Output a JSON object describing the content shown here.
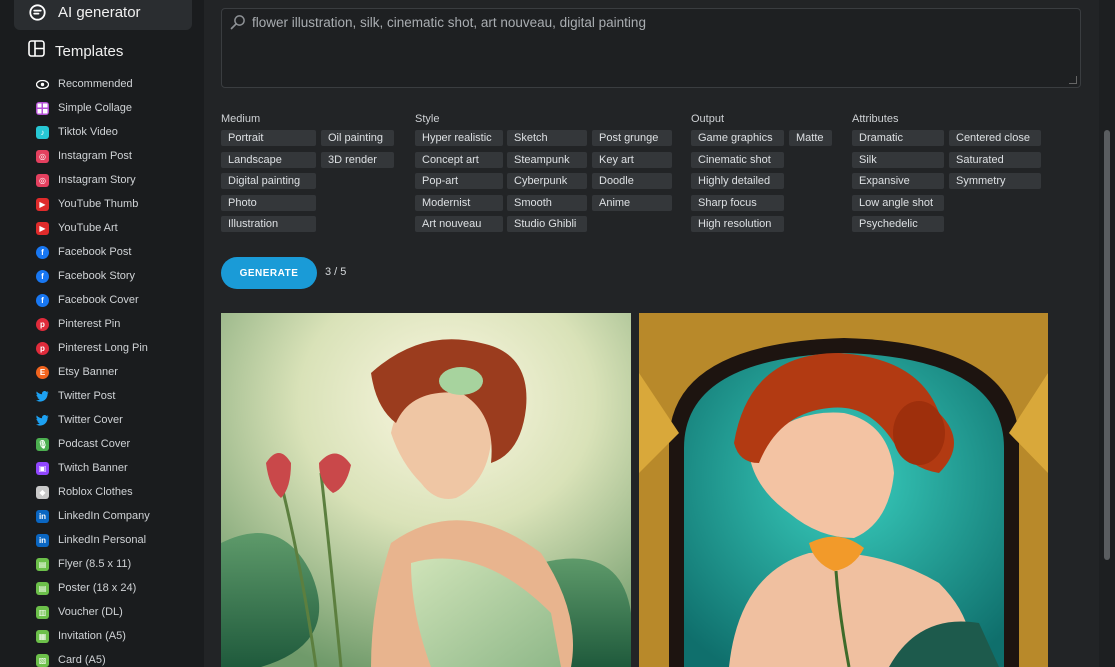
{
  "sidebar": {
    "top_label": "AI generator",
    "templates_label": "Templates",
    "items": [
      {
        "label": "Recommended",
        "icon": "eye-icon",
        "color": "#ffffff",
        "glyph": "👁"
      },
      {
        "label": "Simple Collage",
        "icon": "collage-icon",
        "color": "#b44fd6",
        "glyph": ""
      },
      {
        "label": "Tiktok Video",
        "icon": "tiktok-icon",
        "color": "#27c7d4",
        "glyph": "♪"
      },
      {
        "label": "Instagram Post",
        "icon": "instagram-icon",
        "color": "#e4405f",
        "glyph": "◎"
      },
      {
        "label": "Instagram Story",
        "icon": "instagram-icon",
        "color": "#e4405f",
        "glyph": "◎"
      },
      {
        "label": "YouTube Thumb",
        "icon": "youtube-icon",
        "color": "#e02b2b",
        "glyph": "▶"
      },
      {
        "label": "YouTube Art",
        "icon": "youtube-icon",
        "color": "#e02b2b",
        "glyph": "▶"
      },
      {
        "label": "Facebook Post",
        "icon": "facebook-icon",
        "color": "#1877f2",
        "glyph": "f"
      },
      {
        "label": "Facebook Story",
        "icon": "facebook-icon",
        "color": "#1877f2",
        "glyph": "f"
      },
      {
        "label": "Facebook Cover",
        "icon": "facebook-icon",
        "color": "#1877f2",
        "glyph": "f"
      },
      {
        "label": "Pinterest Pin",
        "icon": "pinterest-icon",
        "color": "#e02b3b",
        "glyph": "p"
      },
      {
        "label": "Pinterest Long Pin",
        "icon": "pinterest-icon",
        "color": "#e02b3b",
        "glyph": "p"
      },
      {
        "label": "Etsy Banner",
        "icon": "etsy-icon",
        "color": "#f1641e",
        "glyph": "E"
      },
      {
        "label": "Twitter Post",
        "icon": "twitter-icon",
        "color": "#1da1f2",
        "glyph": "🐦"
      },
      {
        "label": "Twitter Cover",
        "icon": "twitter-icon",
        "color": "#1da1f2",
        "glyph": "🐦"
      },
      {
        "label": "Podcast Cover",
        "icon": "microphone-icon",
        "color": "#4caf50",
        "glyph": "🎙"
      },
      {
        "label": "Twitch Banner",
        "icon": "twitch-icon",
        "color": "#9146ff",
        "glyph": "▣"
      },
      {
        "label": "Roblox Clothes",
        "icon": "roblox-icon",
        "color": "#c9c9c9",
        "glyph": "◆"
      },
      {
        "label": "LinkedIn Company",
        "icon": "linkedin-icon",
        "color": "#0a66c2",
        "glyph": "in"
      },
      {
        "label": "LinkedIn Personal",
        "icon": "linkedin-icon",
        "color": "#0a66c2",
        "glyph": "in"
      },
      {
        "label": "Flyer (8.5 x 11)",
        "icon": "flyer-icon",
        "color": "#6cc04a",
        "glyph": "▤"
      },
      {
        "label": "Poster (18 x 24)",
        "icon": "poster-icon",
        "color": "#6cc04a",
        "glyph": "▤"
      },
      {
        "label": "Voucher (DL)",
        "icon": "voucher-icon",
        "color": "#6cc04a",
        "glyph": "▥"
      },
      {
        "label": "Invitation (A5)",
        "icon": "invitation-icon",
        "color": "#6cc04a",
        "glyph": "▦"
      },
      {
        "label": "Card (A5)",
        "icon": "card-icon",
        "color": "#6cc04a",
        "glyph": "▧"
      }
    ]
  },
  "prompt": {
    "text": "flower illustration, silk, cinematic shot, art nouveau, digital painting"
  },
  "categories": {
    "medium": {
      "label": "Medium",
      "tags": [
        "Portrait",
        "Oil painting",
        "Landscape",
        "3D render",
        "Digital painting",
        "Photo",
        "Illustration"
      ]
    },
    "style": {
      "label": "Style",
      "tags": [
        "Hyper realistic",
        "Sketch",
        "Post grunge",
        "Concept art",
        "Steampunk",
        "Key art",
        "Pop-art",
        "Cyberpunk",
        "Doodle",
        "Modernist",
        "Smooth",
        "Anime",
        "Art nouveau",
        "Studio Ghibli"
      ]
    },
    "output": {
      "label": "Output",
      "tags": [
        "Game graphics",
        "Matte",
        "Cinematic shot",
        "Highly detailed",
        "Sharp focus",
        "High resolution"
      ]
    },
    "attributes": {
      "label": "Attributes",
      "tags": [
        "Dramatic",
        "Centered close",
        "Silk",
        "Saturated",
        "Expansive",
        "Symmetry",
        "Low angle shot",
        "Psychedelic"
      ]
    }
  },
  "generate": {
    "label": "GENERATE",
    "counter": "3 / 5"
  },
  "colors": {
    "accent": "#1a9bd7",
    "background": "#222426",
    "sidebar": "#1a1c1e",
    "tag": "#34373a"
  }
}
